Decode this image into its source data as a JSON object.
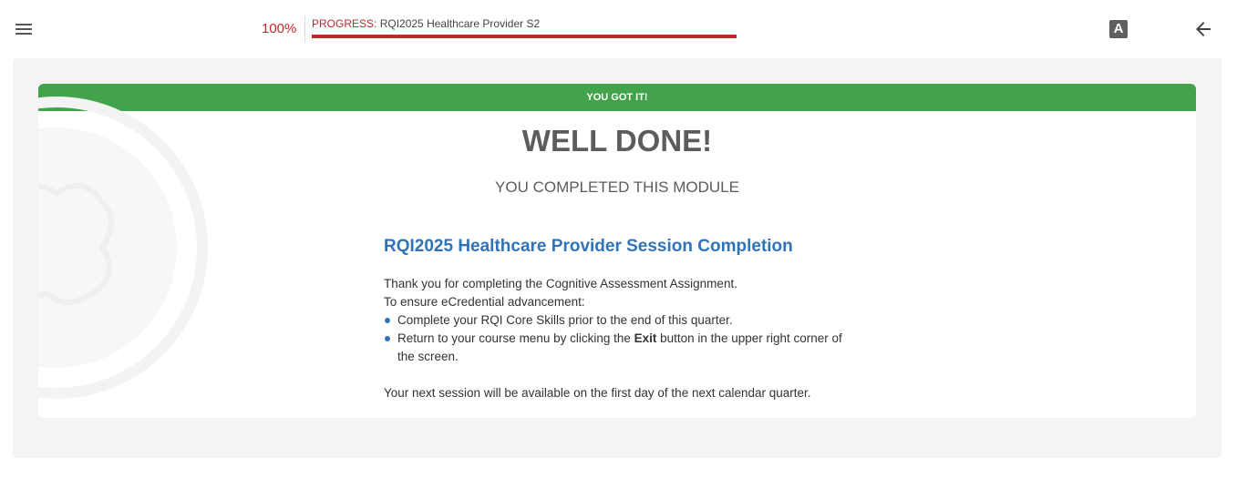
{
  "header": {
    "progress_percent_label": "100%",
    "progress_prefix": "PROGRESS:",
    "course_title": "RQI2025 Healthcare Provider S2",
    "progress_value": 1.0,
    "font_toggle_label": "A",
    "icons": {
      "menu": "hamburger-menu-icon",
      "back": "arrow-left-icon"
    }
  },
  "card": {
    "banner": "YOU GOT IT!",
    "title": "WELL DONE!",
    "subtitle": "YOU COMPLETED THIS MODULE",
    "content": {
      "heading": "RQI2025 Healthcare Provider Session Completion",
      "line1": "Thank you for completing the Cognitive Assessment Assignment.",
      "line2": "To ensure eCredential advancement:",
      "bullet1": "Complete your RQI Core Skills prior to the end of this quarter.",
      "bullet2_pre": "Return to your course menu by clicking the ",
      "bullet2_bold": "Exit",
      "bullet2_post": " button in the upper right corner of the screen.",
      "footer": "Your next session will be available on the first day of the next calendar quarter."
    }
  },
  "colors": {
    "accent_red": "#c0272d",
    "success_green": "#43a34b",
    "heading_blue": "#2f73b9",
    "panel_bg": "#f4f4f4"
  }
}
